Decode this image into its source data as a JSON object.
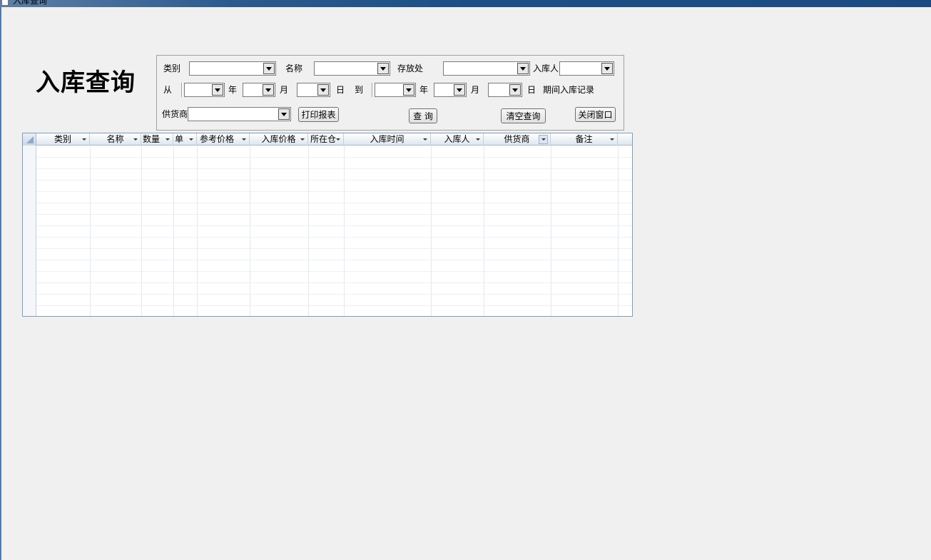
{
  "window": {
    "title": "入库查询"
  },
  "page_title": "入库查询",
  "filters": {
    "category_label": "类别",
    "name_label": "名称",
    "location_label": "存放处",
    "receiver_label": "入库人",
    "from_label": "从",
    "year_label": "年",
    "month_label": "月",
    "day_label": "日",
    "to_label": "到",
    "period_label": "期间入库记录",
    "supplier_label": "供货商"
  },
  "buttons": {
    "print_report": "打印报表",
    "query": "查 询",
    "clear_query": "清空查询",
    "close_window": "关闭窗口"
  },
  "grid": {
    "columns": [
      "类别",
      "名称",
      "数量",
      "单",
      "参考价格",
      "入库价格",
      "所在仓",
      "入库时间",
      "入库人",
      "供货商",
      "备注"
    ]
  }
}
